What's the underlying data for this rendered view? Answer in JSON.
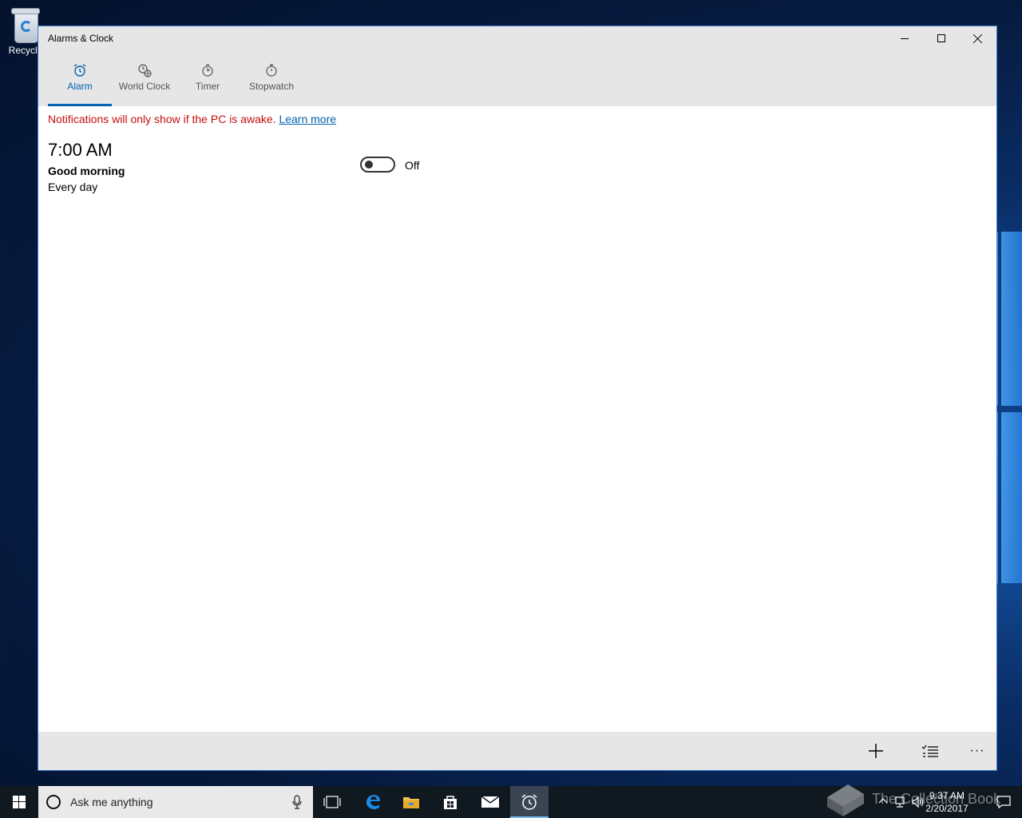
{
  "desktop": {
    "recycle_bin_label": "Recycle"
  },
  "window": {
    "title": "Alarms & Clock",
    "tabs": [
      {
        "label": "Alarm",
        "active": true
      },
      {
        "label": "World Clock"
      },
      {
        "label": "Timer"
      },
      {
        "label": "Stopwatch"
      }
    ],
    "notice": {
      "text": "Notifications will only show if the PC is awake.",
      "link": "Learn more"
    },
    "alarms": [
      {
        "time": "7:00 AM",
        "name": "Good morning",
        "repeat": "Every day",
        "state_label": "Off",
        "enabled": false
      }
    ],
    "bottom_bar": {
      "more_label": "···"
    }
  },
  "taskbar": {
    "search_placeholder": "Ask me anything",
    "clock_time": "9:37 AM",
    "clock_date": "2/20/2017"
  },
  "watermark": "The Collection Book",
  "colors": {
    "accent": "#0063b1",
    "notice_red": "#c50f0f",
    "chrome_gray": "#e6e6e6",
    "taskbar": "#101820"
  }
}
